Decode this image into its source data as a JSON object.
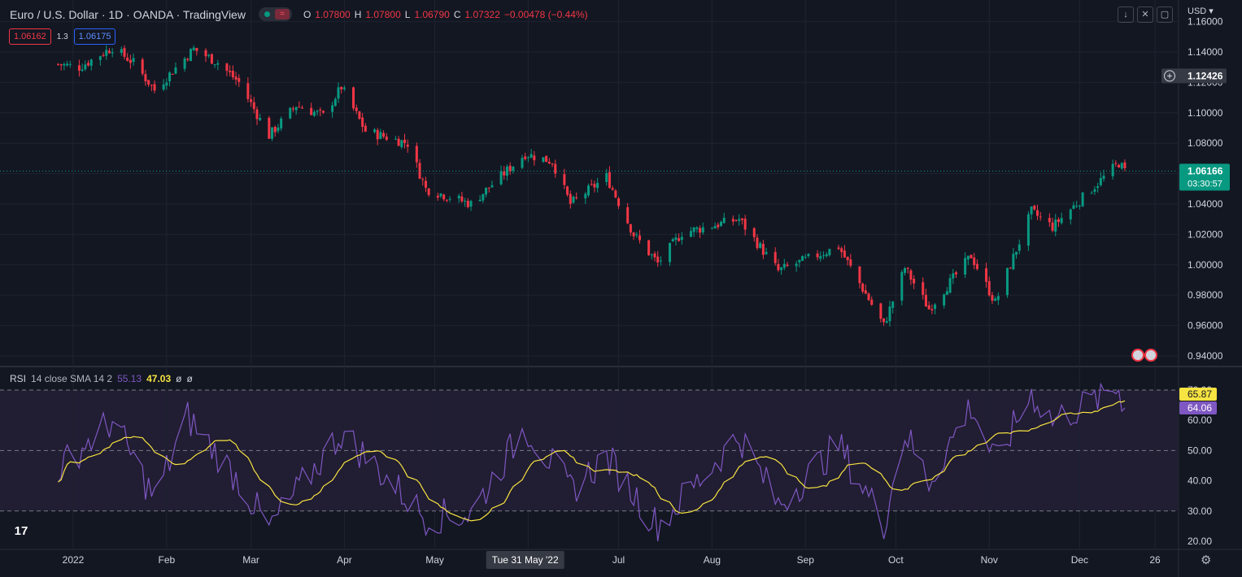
{
  "header": {
    "title": "Euro / U.S. Dollar · 1D · OANDA · TradingView",
    "ohlc": [
      {
        "label": "O",
        "value": "1.07800"
      },
      {
        "label": "H",
        "value": "1.07800"
      },
      {
        "label": "L",
        "value": "1.06790"
      },
      {
        "label": "C",
        "value": "1.07322"
      }
    ],
    "change": "−0.00478 (−0.44%)",
    "sell_price": "1.06162",
    "spread": "1.3",
    "buy_price": "1.06175",
    "currency": "USD"
  },
  "price_axis": {
    "ticks": [
      "1.16000",
      "1.14000",
      "1.12000",
      "1.10000",
      "1.08000",
      "1.06000",
      "1.04000",
      "1.02000",
      "1.00000",
      "0.98000",
      "0.96000",
      "0.94000"
    ],
    "crosshair_label": "1.12426",
    "last_price_label": "1.06166",
    "countdown_label": "03:30:57"
  },
  "rsi_legend": {
    "name": "RSI",
    "params": "14 close SMA 14 2",
    "rsi": "55.13",
    "sma": "47.03",
    "extra1": "ø",
    "extra2": "ø"
  },
  "rsi_axis": {
    "ticks": [
      "70.00",
      "60.00",
      "50.00",
      "40.00",
      "30.00",
      "20.00"
    ],
    "sma_label": "65.87",
    "rsi_label": "64.06"
  },
  "time_axis": {
    "labels": [
      "2022",
      "Feb",
      "Mar",
      "Apr",
      "May",
      "Jun",
      "Jul",
      "Aug",
      "Sep",
      "Oct",
      "Nov",
      "Dec",
      "26"
    ],
    "crosshair_label": "Tue 31 May '22"
  },
  "colors": {
    "up": "#089981",
    "down": "#f23645",
    "rsi": "#7e57c2",
    "sma": "#f7e341",
    "background": "#131722",
    "grid": "#1f2330"
  },
  "chart_data": {
    "type": "candlestick",
    "symbol": "EURUSD",
    "interval": "1D",
    "ylim": [
      0.94,
      1.16
    ],
    "rsi_ylim": [
      20,
      70
    ],
    "rsi_bands": [
      30,
      50,
      70
    ],
    "price_control_points": [
      {
        "date": "2021-12-27",
        "close": 1.132
      },
      {
        "date": "2022-01-03",
        "close": 1.13
      },
      {
        "date": "2022-01-14",
        "close": 1.143
      },
      {
        "date": "2022-01-21",
        "close": 1.133
      },
      {
        "date": "2022-01-28",
        "close": 1.115
      },
      {
        "date": "2022-02-10",
        "close": 1.142
      },
      {
        "date": "2022-02-18",
        "close": 1.133
      },
      {
        "date": "2022-02-25",
        "close": 1.12
      },
      {
        "date": "2022-03-07",
        "close": 1.085
      },
      {
        "date": "2022-03-16",
        "close": 1.105
      },
      {
        "date": "2022-03-25",
        "close": 1.098
      },
      {
        "date": "2022-03-31",
        "close": 1.117
      },
      {
        "date": "2022-04-08",
        "close": 1.088
      },
      {
        "date": "2022-04-22",
        "close": 1.08
      },
      {
        "date": "2022-04-28",
        "close": 1.05
      },
      {
        "date": "2022-05-13",
        "close": 1.04
      },
      {
        "date": "2022-05-31",
        "close": 1.073
      },
      {
        "date": "2022-06-09",
        "close": 1.068
      },
      {
        "date": "2022-06-15",
        "close": 1.04
      },
      {
        "date": "2022-06-27",
        "close": 1.058
      },
      {
        "date": "2022-07-06",
        "close": 1.02
      },
      {
        "date": "2022-07-14",
        "close": 1.001
      },
      {
        "date": "2022-07-22",
        "close": 1.021
      },
      {
        "date": "2022-08-10",
        "close": 1.03
      },
      {
        "date": "2022-08-23",
        "close": 0.996
      },
      {
        "date": "2022-09-12",
        "close": 1.012
      },
      {
        "date": "2022-09-27",
        "close": 0.96
      },
      {
        "date": "2022-10-04",
        "close": 0.998
      },
      {
        "date": "2022-10-12",
        "close": 0.971
      },
      {
        "date": "2022-10-26",
        "close": 1.006
      },
      {
        "date": "2022-11-03",
        "close": 0.975
      },
      {
        "date": "2022-11-15",
        "close": 1.035
      },
      {
        "date": "2022-11-22",
        "close": 1.025
      },
      {
        "date": "2022-12-05",
        "close": 1.05
      },
      {
        "date": "2022-12-14",
        "close": 1.067
      },
      {
        "date": "2022-12-16",
        "close": 1.0617
      }
    ],
    "rsi_control_points": [
      {
        "date": "2021-12-27",
        "rsi": 44
      },
      {
        "date": "2022-01-14",
        "rsi": 60
      },
      {
        "date": "2022-01-28",
        "rsi": 34
      },
      {
        "date": "2022-02-08",
        "rsi": 61
      },
      {
        "date": "2022-02-25",
        "rsi": 40
      },
      {
        "date": "2022-03-07",
        "rsi": 24
      },
      {
        "date": "2022-03-31",
        "rsi": 56
      },
      {
        "date": "2022-04-28",
        "rsi": 28
      },
      {
        "date": "2022-05-13",
        "rsi": 29
      },
      {
        "date": "2022-05-31",
        "rsi": 58
      },
      {
        "date": "2022-06-15",
        "rsi": 37
      },
      {
        "date": "2022-06-27",
        "rsi": 48
      },
      {
        "date": "2022-07-14",
        "rsi": 25
      },
      {
        "date": "2022-08-10",
        "rsi": 55
      },
      {
        "date": "2022-08-23",
        "rsi": 32
      },
      {
        "date": "2022-09-12",
        "rsi": 52
      },
      {
        "date": "2022-09-27",
        "rsi": 26
      },
      {
        "date": "2022-10-04",
        "rsi": 56
      },
      {
        "date": "2022-10-12",
        "rsi": 40
      },
      {
        "date": "2022-10-26",
        "rsi": 65
      },
      {
        "date": "2022-11-03",
        "rsi": 46
      },
      {
        "date": "2022-11-15",
        "rsi": 69
      },
      {
        "date": "2022-11-22",
        "rsi": 60
      },
      {
        "date": "2022-12-05",
        "rsi": 66
      },
      {
        "date": "2022-12-14",
        "rsi": 71
      },
      {
        "date": "2022-12-16",
        "rsi": 64.06
      }
    ]
  }
}
